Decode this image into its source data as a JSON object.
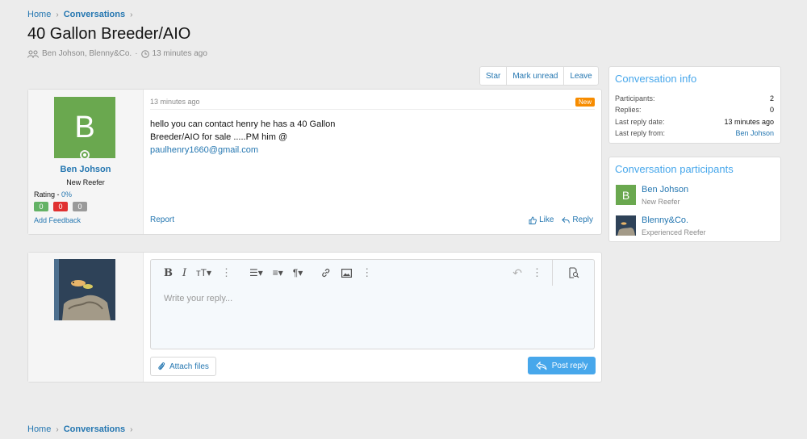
{
  "breadcrumb": {
    "home": "Home",
    "current": "Conversations",
    "sep": "›"
  },
  "page_title": "40 Gallon Breeder/AIO",
  "meta": {
    "participants": "Ben Johson, Blenny&Co.",
    "dot": "·",
    "time": "13 minutes ago"
  },
  "toolbar": {
    "star": "Star",
    "mark_unread": "Mark unread",
    "leave": "Leave"
  },
  "message": {
    "avatar_letter": "B",
    "username": "Ben Johson",
    "user_title": "New Reefer",
    "rating_label": "Rating - ",
    "rating_value": "0%",
    "feedback": [
      "0",
      "0",
      "0"
    ],
    "add_feedback": "Add Feedback",
    "date": "13 minutes ago",
    "new_tag": "New",
    "body": "hello you can contact henry he has a 40 Gallon Breeder/AIO for sale .....PM him @",
    "email": "paulhenry1660@gmail.com",
    "report": "Report",
    "like": "Like",
    "reply": "Reply"
  },
  "reply_box": {
    "placeholder": "Write your reply...",
    "attach": "Attach files",
    "post": "Post reply"
  },
  "conversation_info": {
    "title": "Conversation info",
    "rows": [
      {
        "label": "Participants:",
        "value": "2"
      },
      {
        "label": "Replies:",
        "value": "0"
      },
      {
        "label": "Last reply date:",
        "value": "13 minutes ago"
      },
      {
        "label": "Last reply from:",
        "value": "Ben Johson"
      }
    ]
  },
  "participants": {
    "title": "Conversation participants",
    "items": [
      {
        "avatar_letter": "B",
        "name": "Ben Johson",
        "title": "New Reefer"
      },
      {
        "name": "Blenny&Co.",
        "title": "Experienced Reefer"
      }
    ]
  },
  "colors": {
    "link": "#2577b1",
    "accent": "#47a7eb",
    "avatar_green": "#6aa84f",
    "new_tag": "#f78c00",
    "like_green": "#63b265",
    "dislike_red": "#e03030",
    "neutral_gray": "#9a9a9a"
  }
}
